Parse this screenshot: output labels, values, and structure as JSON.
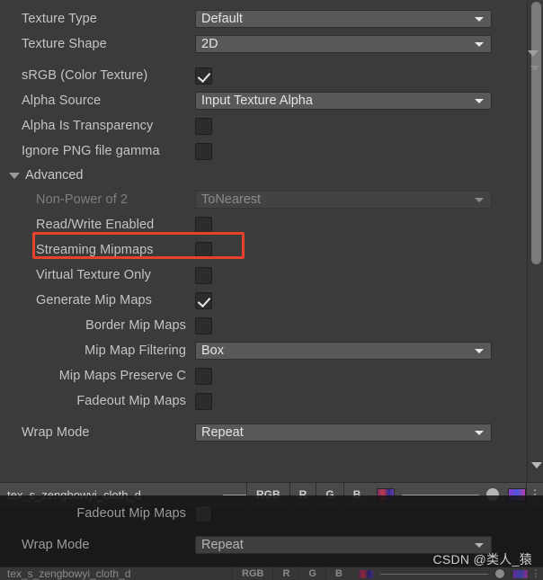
{
  "colors": {
    "panel_bg": "#3b3b3b",
    "dropdown_bg": "#585858",
    "highlight_border": "#e8412c",
    "label_text": "#c4c4c4",
    "disabled_text": "#7e7e7e"
  },
  "inspector": {
    "basic_rows": [
      {
        "label": "Texture Type",
        "control": "dropdown",
        "value": "Default",
        "disabled": false
      },
      {
        "label": "Texture Shape",
        "control": "dropdown",
        "value": "2D",
        "disabled": false
      }
    ],
    "color_rows": [
      {
        "label": "sRGB (Color Texture)",
        "control": "checkbox",
        "checked": true,
        "disabled": false
      },
      {
        "label": "Alpha Source",
        "control": "dropdown",
        "value": "Input Texture Alpha",
        "disabled": false
      },
      {
        "label": "Alpha Is Transparency",
        "control": "checkbox",
        "checked": false,
        "disabled": false
      },
      {
        "label": "Ignore PNG file gamma",
        "control": "checkbox",
        "checked": false,
        "disabled": false
      }
    ],
    "advanced": {
      "header": "Advanced",
      "expanded": true,
      "rows": [
        {
          "label": "Non-Power of 2",
          "control": "dropdown",
          "value": "ToNearest",
          "disabled": true,
          "indent": 1
        },
        {
          "label": "Read/Write Enabled",
          "control": "checkbox",
          "checked": false,
          "disabled": false,
          "indent": 1,
          "highlighted": true
        },
        {
          "label": "Streaming Mipmaps",
          "control": "checkbox",
          "checked": false,
          "disabled": false,
          "indent": 1
        },
        {
          "label": "Virtual Texture Only",
          "control": "checkbox",
          "checked": false,
          "disabled": false,
          "indent": 1
        },
        {
          "label": "Generate Mip Maps",
          "control": "checkbox",
          "checked": true,
          "disabled": false,
          "indent": 1
        },
        {
          "label": "Border Mip Maps",
          "control": "checkbox",
          "checked": false,
          "disabled": false,
          "indent": 2
        },
        {
          "label": "Mip Map Filtering",
          "control": "dropdown",
          "value": "Box",
          "disabled": false,
          "indent": 2
        },
        {
          "label": "Mip Maps Preserve C",
          "control": "checkbox",
          "checked": false,
          "disabled": false,
          "indent": 2
        },
        {
          "label": "Fadeout Mip Maps",
          "control": "checkbox",
          "checked": false,
          "disabled": false,
          "indent": 2
        }
      ]
    },
    "wrap_row": {
      "label": "Wrap Mode",
      "control": "dropdown",
      "value": "Repeat",
      "disabled": false
    }
  },
  "preview_strip": {
    "asset_name": "tex_s_zengbowyi_cloth_d",
    "channels": [
      "RGB",
      "R",
      "G",
      "B"
    ],
    "kebab": "⋮"
  },
  "overlay": {
    "rows": [
      {
        "label": "Fadeout Mip Maps",
        "control": "checkbox",
        "checked": false
      },
      {
        "label": "Wrap Mode",
        "control": "dropdown",
        "value": "Repeat"
      }
    ],
    "strip": {
      "asset_name": "tex_s_zengbowyi_cloth_d",
      "channels": [
        "RGB",
        "R",
        "G",
        "B"
      ],
      "kebab": "⋮"
    }
  },
  "watermark": "CSDN @类人_猿"
}
